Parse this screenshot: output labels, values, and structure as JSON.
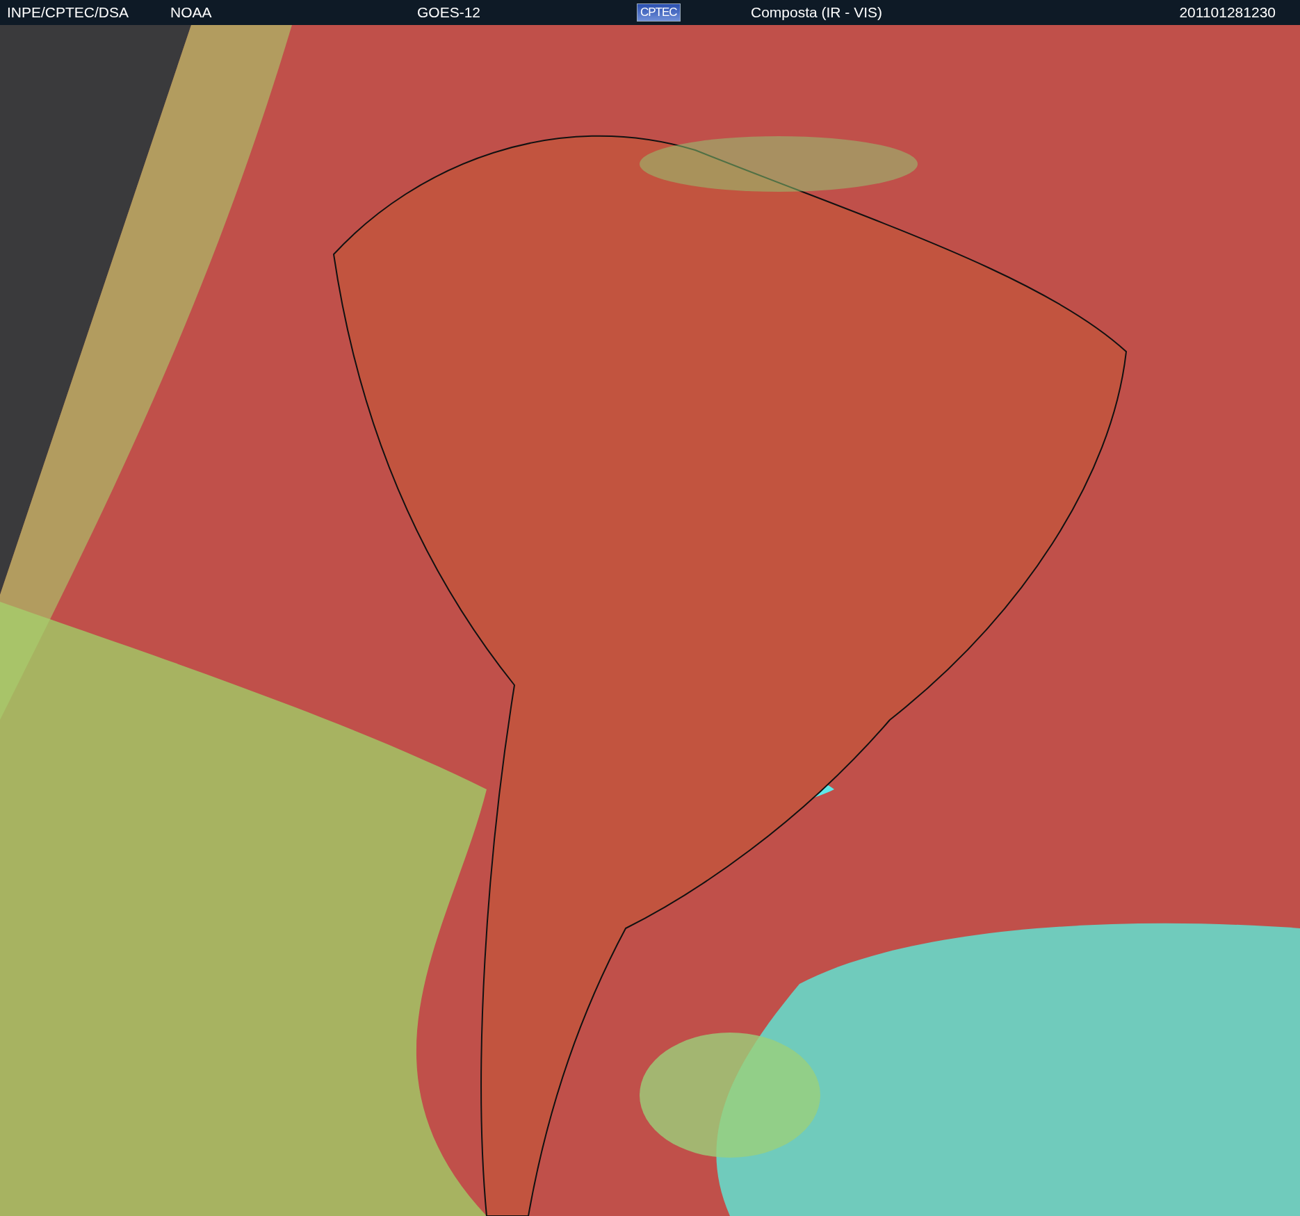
{
  "header": {
    "source": "INPE/CPTEC/DSA",
    "agency": "NOAA",
    "satellite": "GOES-12",
    "logo": "CPTEC",
    "product": "Composta (IR - VIS)",
    "timestamp": "201101281230"
  }
}
